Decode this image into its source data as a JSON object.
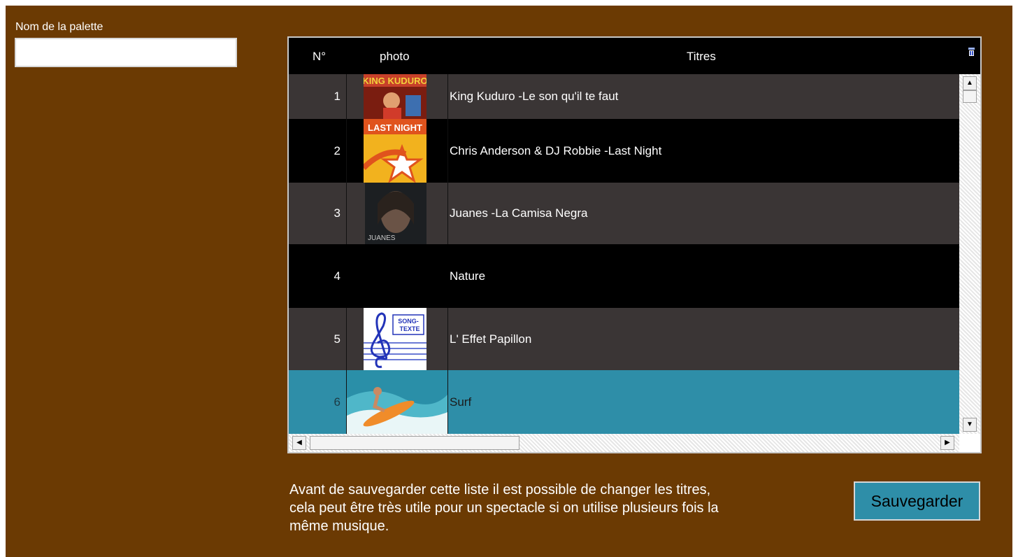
{
  "palette": {
    "label": "Nom de la palette",
    "value": "",
    "placeholder": ""
  },
  "grid": {
    "headers": {
      "num": "N°",
      "photo": "photo",
      "title": "Titres"
    },
    "rows": [
      {
        "num": "1",
        "title": "King Kuduro -Le son qu'il te faut",
        "photo_icon": "king-kuduro-cover-thumbnail",
        "selected": false
      },
      {
        "num": "2",
        "title": "Chris Anderson & DJ Robbie  -Last Night",
        "photo_icon": "last-night-cover-thumbnail",
        "photo_text": "LAST NIGHT",
        "selected": false
      },
      {
        "num": "3",
        "title": "Juanes -La Camisa Negra",
        "photo_icon": "juanes-portrait-thumbnail",
        "photo_text": "JUANES",
        "selected": false
      },
      {
        "num": "4",
        "title": "Nature",
        "photo_icon": "",
        "selected": false
      },
      {
        "num": "5",
        "title": "L' Effet Papillon",
        "photo_icon": "song-texte-treble-clef-thumbnail",
        "photo_text": "SONG-TEXTE",
        "selected": false
      },
      {
        "num": "6",
        "title": "Surf",
        "photo_icon": "surfer-wave-thumbnail",
        "selected": true
      }
    ]
  },
  "help_text": {
    "line1": "Avant de sauvegarder cette liste il est possible de changer les titres,",
    "line2": "cela peut être très utile pour un spectacle si on utilise plusieurs fois la",
    "line3": "même musique."
  },
  "save_button": {
    "label": "Sauvegarder"
  },
  "colors": {
    "background": "#6b3a03",
    "row_odd": "#3a3535",
    "row_even": "#000000",
    "selected_row": "#2e8ea8",
    "button": "#2e8ea8"
  },
  "icons": {
    "scroll_up": "arrow-up-icon",
    "scroll_down": "arrow-down-icon",
    "scroll_left": "arrow-left-icon",
    "scroll_right": "arrow-right-icon",
    "column_settings": "column-settings-icon"
  }
}
